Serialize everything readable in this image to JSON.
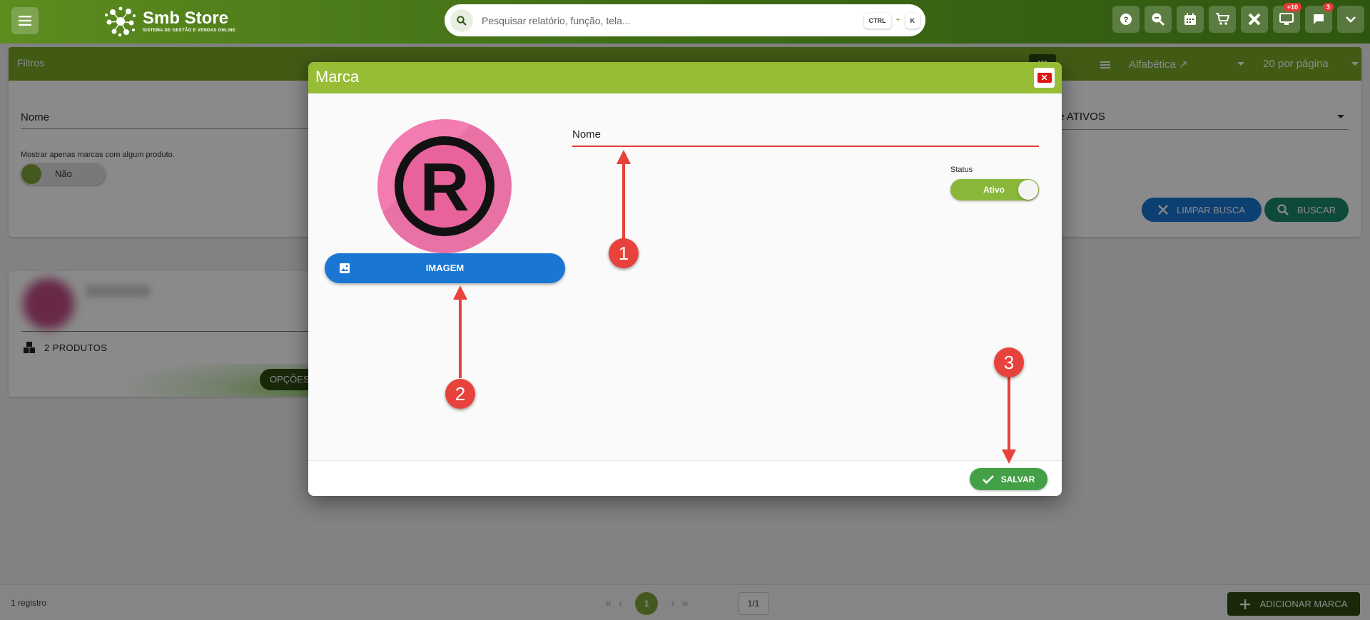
{
  "header": {
    "logo_title": "Smb Store",
    "logo_subtitle": "SISTEMA DE GESTÃO E VENDAS ONLINE",
    "search_placeholder": "Pesquisar relatório, função, tela...",
    "shortcut_key1": "CTRL",
    "shortcut_plus": "+",
    "shortcut_key2": "K",
    "badge_monitor": "+10",
    "badge_chat": "3",
    "icons": [
      "help-icon",
      "zoom-search-icon",
      "calendar-icon",
      "cart-icon",
      "tools-icon",
      "monitor-icon",
      "chat-icon",
      "chevron-down-icon"
    ]
  },
  "filters": {
    "title": "Filtros",
    "sort_label": "Alfabética ↗",
    "per_page": "20 por página",
    "nome_label": "Nome",
    "status_value": "te ATIVOS",
    "checkbox_label": "Mostrar apenas marcas com algum produto.",
    "toggle_value": "Não",
    "clear_button": "LIMPAR BUSCA",
    "search_button": "BUSCAR"
  },
  "brand_card": {
    "product_count": "2 PRODUTOS",
    "options_button": "OPÇÕES"
  },
  "footer": {
    "records": "1 registro",
    "current_page": "1",
    "page_of": "1/1",
    "add_button": "ADICIONAR MARCA"
  },
  "modal": {
    "title": "Marca",
    "close_glyph": "✕",
    "image_button": "IMAGEM",
    "brand_letter": "R",
    "name_label": "Nome",
    "status_label": "Status",
    "status_value": "Ativo",
    "save_button": "SALVAR"
  },
  "annotations": {
    "marker_1": "1",
    "marker_2": "2",
    "marker_3": "3"
  },
  "colors": {
    "accent_green": "#97bd37",
    "brand_pink": "#f27cb0",
    "primary_blue": "#1976d2",
    "annotation_red": "#e8423c"
  }
}
